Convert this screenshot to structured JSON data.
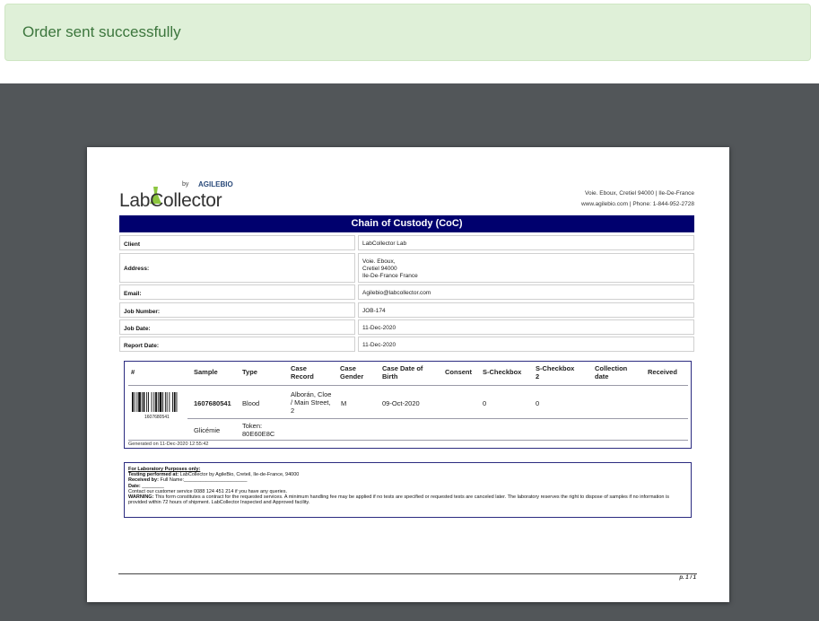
{
  "alert": {
    "message": "Order sent successfully"
  },
  "doc": {
    "logo": {
      "by": "by",
      "brand": "AGILEBIO",
      "name": "LabCollector"
    },
    "header_address": {
      "line1_a": "Voie. Eboux, Cretiel 94000",
      "line1_b": "Ile-De-France",
      "line2_a": "www.agilebio.com",
      "line2_b": "Phone: 1-844-952-2728"
    },
    "title": "Chain of Custody (CoC)",
    "info": [
      {
        "label": "Client",
        "value": [
          "LabCollector Lab"
        ]
      },
      {
        "label": "Address:",
        "value": [
          "Voie. Eboux,",
          "Cretiel  94000",
          "Ile-De-France France"
        ]
      },
      {
        "label": "Email:",
        "value": [
          "Agilebio@labcollector.com"
        ]
      },
      {
        "label": "Job Number:",
        "value": [
          "JOB-174"
        ]
      },
      {
        "label": "Job Date:",
        "value": [
          "11-Dec-2020"
        ]
      },
      {
        "label": "Report Date:",
        "value": [
          "11-Dec-2020"
        ]
      }
    ],
    "samples": {
      "headers": {
        "num": "#",
        "sample": "Sample",
        "type": "Type",
        "case_record": [
          "Case",
          "Record"
        ],
        "case_gender": [
          "Case",
          "Gender"
        ],
        "case_dob": [
          "Case Date of",
          "Birth"
        ],
        "consent": "Consent",
        "s_checkbox": "S-Checkbox",
        "s_checkbox2": [
          "S-Checkbox",
          "2"
        ],
        "collection_date": [
          "Collection",
          "date"
        ],
        "received": "Received"
      },
      "row": {
        "barcode_number": "1607680541",
        "sample": "1607680541",
        "type": "Blood",
        "case_record": [
          "Alborán, Cloe",
          "/ Main Street,",
          "2"
        ],
        "gender": "M",
        "dob": "09-Oct-2020",
        "s_checkbox": "0",
        "s_checkbox2": "0"
      },
      "subrow": {
        "name": "Glicémie",
        "token": [
          "Token:",
          "80E60E8C"
        ]
      },
      "generated": "Generated on 11-Dec-2020 12:55:42"
    },
    "lab": {
      "heading": "For Laboratory Purposes only:",
      "testing_label": "Testing performed at:",
      "testing_value": " LabCollector by AgileBio, Creteil, Ile-de-France, 94000",
      "received_label": "Received by:",
      "received_value": " Full Name:_______________________",
      "date_label": "Date:",
      "date_value": " ________",
      "contact": "Contact our customer service 0088 124 451 214  if you have any queries.",
      "warning_label": "WARNING:",
      "warning_text": " This form constitutes a contract for the requested services. A minimum handling fee may be applied if no tests are specified or requested tests are canceled later. The laboratory reserves the right to dispose of samples if no information is provided within 72 hours of shipment. LabCollector Inspected and Approved facility."
    },
    "page_number": "p. 1 / 1"
  }
}
